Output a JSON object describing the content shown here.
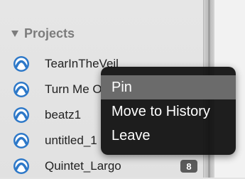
{
  "sidebar": {
    "section_title": "Projects",
    "items": [
      {
        "label": "TearInTheVeil",
        "badge": ""
      },
      {
        "label": "Turn Me On",
        "badge": ""
      },
      {
        "label": "beatz1",
        "badge": ""
      },
      {
        "label": "untitled_1",
        "badge": ""
      },
      {
        "label": "Quintet_Largo",
        "badge": "8"
      }
    ],
    "item_icon": "project-logo-icon"
  },
  "context_menu": {
    "items": [
      {
        "label": "Pin"
      },
      {
        "label": "Move to History"
      },
      {
        "label": "Leave"
      }
    ]
  },
  "colors": {
    "icon_blue": "#2d78c8",
    "menu_background": "#141414",
    "menu_highlight": "#6b6b6b",
    "badge": "#5b5b5b"
  }
}
